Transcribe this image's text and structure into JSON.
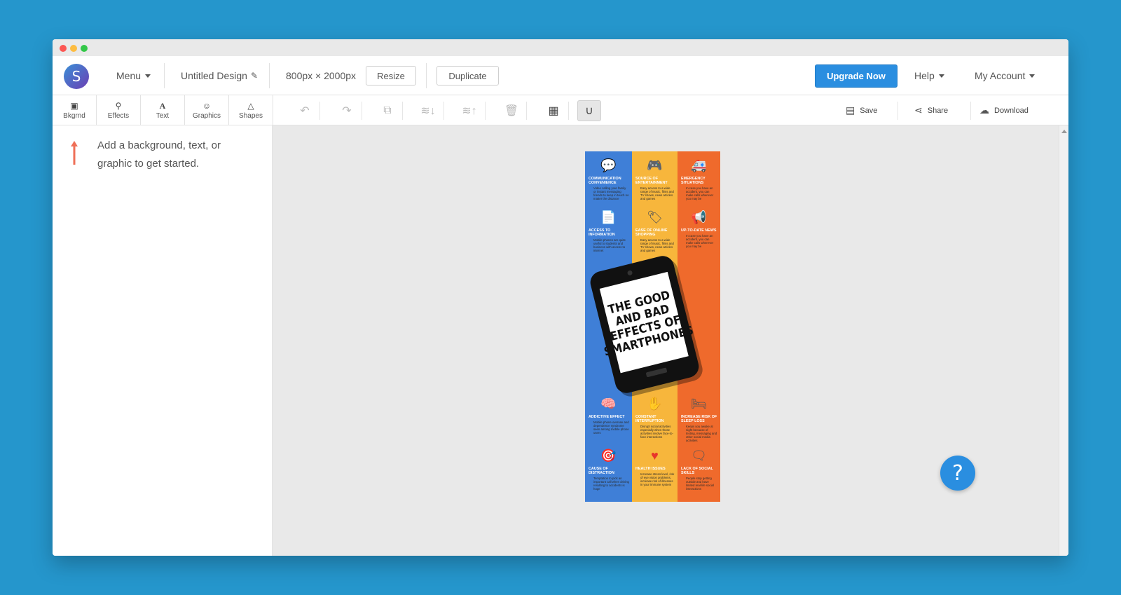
{
  "topbar": {
    "logo_letter": "S",
    "menu": "Menu",
    "design_name": "Untitled Design",
    "dimensions": "800px × 2000px",
    "resize": "Resize",
    "duplicate": "Duplicate",
    "upgrade": "Upgrade Now",
    "help": "Help",
    "account": "My Account"
  },
  "tools": [
    {
      "label": "Bkgrnd",
      "icon": "image-icon"
    },
    {
      "label": "Effects",
      "icon": "magic-wand-icon"
    },
    {
      "label": "Text",
      "icon": "text-icon"
    },
    {
      "label": "Graphics",
      "icon": "smiley-icon"
    },
    {
      "label": "Shapes",
      "icon": "triangle-icon"
    }
  ],
  "actions": {
    "save": "Save",
    "share": "Share",
    "download": "Download"
  },
  "left_panel": {
    "hint": "Add a background, text, or graphic to get started."
  },
  "design": {
    "title": "THE GOOD AND BAD EFFECTS OF SMARTPHONES",
    "items": [
      {
        "title": "COMMUNICATION CONVENIENCE",
        "text": "Video calling your family or instant messaging friends to keep in touch no matter the distance"
      },
      {
        "title": "SOURCE OF ENTERTAINMENT",
        "text": "Easy access to a wide range of music, films and TV shows, news articles and games"
      },
      {
        "title": "EMERGENCY SITUATIONS",
        "text": "In case you have an accident, you can make calls wherever you may be"
      },
      {
        "title": "ACCESS TO INFORMATION",
        "text": "Mobile phones are quite useful to students and business with access to internet"
      },
      {
        "title": "EASE OF ONLINE SHOPPING",
        "text": "Easy access to a wide range of music, films and TV shows, news articles and games"
      },
      {
        "title": "UP-TO-DATE NEWS",
        "text": "In case you have an accident, you can make calls wherever you may be"
      },
      {
        "title": "ADDICTIVE EFFECT",
        "text": "Mobile phone overuse and dependence syndrome seen among mobile phone users"
      },
      {
        "title": "CONSTANT INTERRUPTION",
        "text": "Disrupt social activities especially when those activities involve face-to-face interactions"
      },
      {
        "title": "INCREASE RISK OF SLEEP LOSS",
        "text": "Keeps you awake at night because of texting, messaging and other social media activities"
      },
      {
        "title": "CAUSE OF DISTRACTION",
        "text": "Temptation to pick an important call when driving resulting to accidents is huge"
      },
      {
        "title": "HEALTH ISSUES",
        "text": "Increase stress level, risk of eye vision problems, increase risk of illnesses in your immune system"
      },
      {
        "title": "LACK OF SOCIAL SKILLS",
        "text": "People stop getting outside and have limited real-life social interactions"
      }
    ]
  },
  "help_button": "?",
  "colors": {
    "background": "#2596cc",
    "accent": "#2a8ee0",
    "col_blue": "#3f7fd7",
    "col_yellow": "#f7b63c",
    "col_orange": "#ef6a2c"
  }
}
